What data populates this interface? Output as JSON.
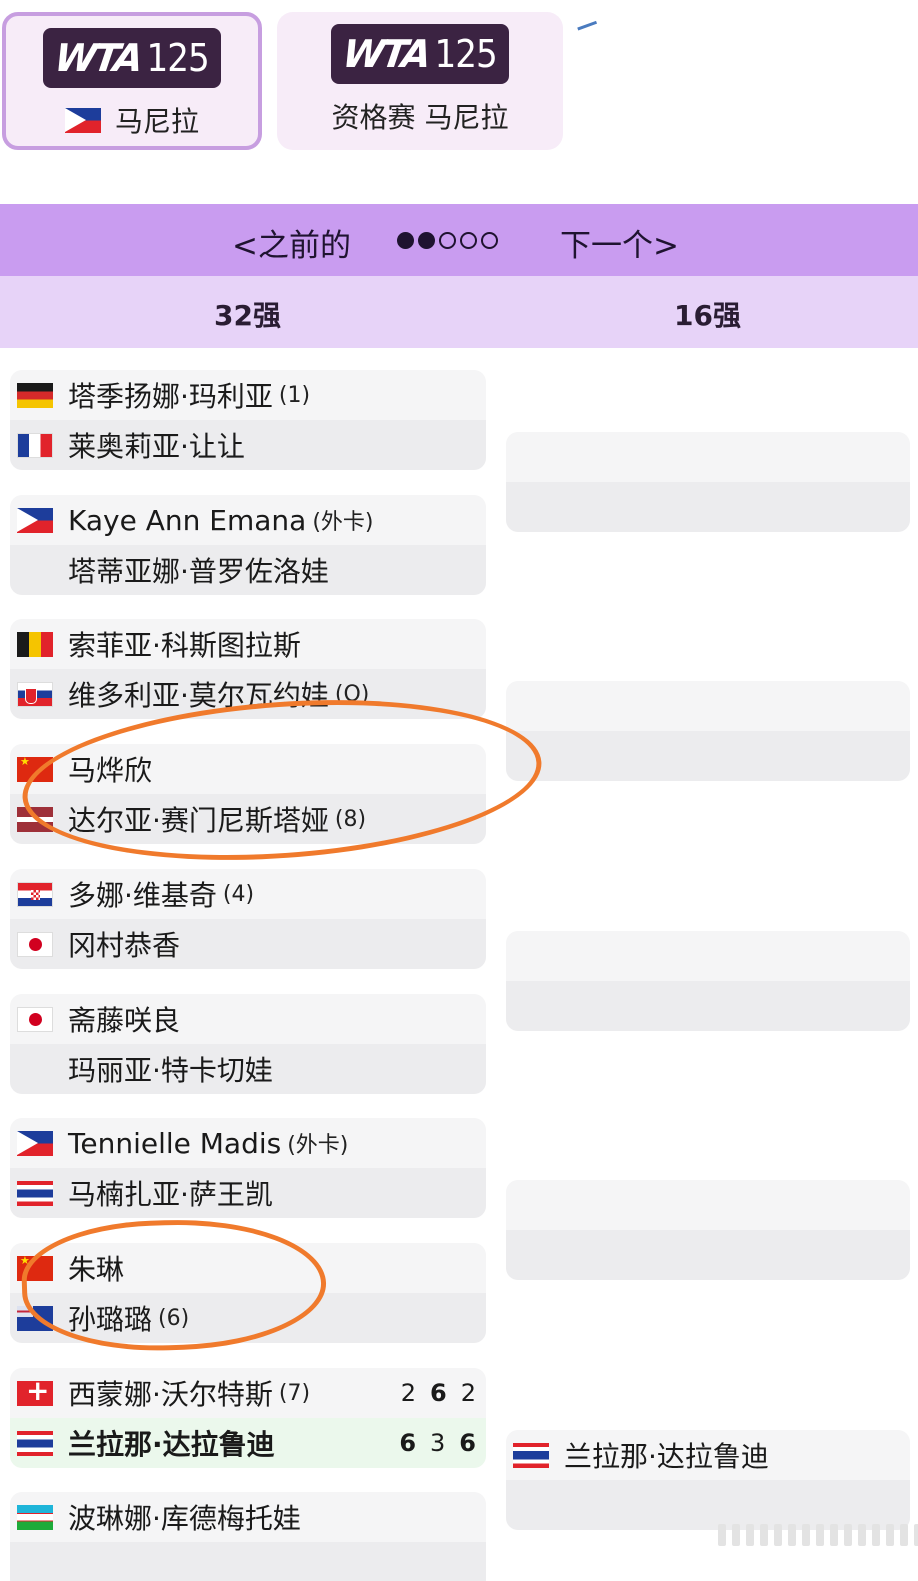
{
  "tournaments": [
    {
      "logo_mark": "WTA",
      "logo_num": "125",
      "flag": "ph-flag-icon",
      "label": "马尼拉",
      "active": true
    },
    {
      "logo_mark": "WTA",
      "logo_num": "125",
      "label": "资格赛 马尼拉",
      "active": false
    }
  ],
  "nav": {
    "prev_label": "<之前的",
    "next_label": "下一个>",
    "page_dots": 5,
    "current_page": 2
  },
  "rounds": {
    "left": "32强",
    "right": "16强"
  },
  "matches": [
    {
      "p1": {
        "flag": "de",
        "name": "塔季扬娜·玛利亚",
        "seed": "(1)"
      },
      "p2": {
        "flag": "fr",
        "name": "莱奥莉亚·让让",
        "seed": ""
      }
    },
    {
      "p1": {
        "flag": "ph",
        "name": "Kaye Ann Emana",
        "seed": "(外卡)"
      },
      "p2": {
        "flag": "",
        "name": "塔蒂亚娜·普罗佐洛娃",
        "seed": ""
      }
    },
    {
      "p1": {
        "flag": "be",
        "name": "索菲亚·科斯图拉斯",
        "seed": ""
      },
      "p2": {
        "flag": "sk",
        "name": "维多利亚·莫尔瓦约娃",
        "seed": "(Q)"
      }
    },
    {
      "p1": {
        "flag": "cn",
        "name": "马烨欣",
        "seed": ""
      },
      "p2": {
        "flag": "lv",
        "name": "达尔亚·赛门尼斯塔娅",
        "seed": "(8)"
      }
    },
    {
      "p1": {
        "flag": "hr",
        "name": "多娜·维基奇",
        "seed": "(4)"
      },
      "p2": {
        "flag": "jp",
        "name": "冈村恭香",
        "seed": ""
      }
    },
    {
      "p1": {
        "flag": "jp",
        "name": "斋藤咲良",
        "seed": ""
      },
      "p2": {
        "flag": "",
        "name": "玛丽亚·特卡切娃",
        "seed": ""
      }
    },
    {
      "p1": {
        "flag": "ph",
        "name": "Tennielle Madis",
        "seed": "(外卡)"
      },
      "p2": {
        "flag": "th",
        "name": "马楠扎亚·萨王凯",
        "seed": ""
      }
    },
    {
      "p1": {
        "flag": "cn",
        "name": "朱琳",
        "seed": ""
      },
      "p2": {
        "flag": "nz",
        "name": "孙璐璐",
        "seed": "(6)"
      }
    },
    {
      "p1": {
        "flag": "ch",
        "name": "西蒙娜·沃尔特斯",
        "seed": "(7)",
        "scores": [
          "2",
          "6",
          "2"
        ]
      },
      "p2": {
        "flag": "th",
        "name": "兰拉那·达拉鲁迪",
        "seed": "",
        "winner": true,
        "scores": [
          "6",
          "3",
          "6"
        ]
      }
    },
    {
      "p1": {
        "flag": "uz",
        "name": "波琳娜·库德梅托娃",
        "seed": ""
      },
      "p2": {
        "flag": "",
        "name": "",
        "seed": ""
      }
    }
  ],
  "round_16": [
    {
      "p1": {
        "flag": "",
        "name": ""
      },
      "p2": {
        "flag": "",
        "name": ""
      }
    },
    {
      "p1": {
        "flag": "",
        "name": ""
      },
      "p2": {
        "flag": "",
        "name": ""
      }
    },
    {
      "p1": {
        "flag": "",
        "name": ""
      },
      "p2": {
        "flag": "",
        "name": ""
      }
    },
    {
      "p1": {
        "flag": "",
        "name": ""
      },
      "p2": {
        "flag": "",
        "name": ""
      }
    },
    {
      "p1": {
        "flag": "th",
        "name": "兰拉那·达拉鲁迪"
      },
      "p2": {
        "flag": "",
        "name": ""
      }
    }
  ],
  "colors": {
    "nav_bar": "#c99cf0",
    "round_bar": "#e7d3f8",
    "winner_row": "#ebf8ec",
    "annotation": "#f07a2c",
    "logo_bg": "#3b2342"
  }
}
